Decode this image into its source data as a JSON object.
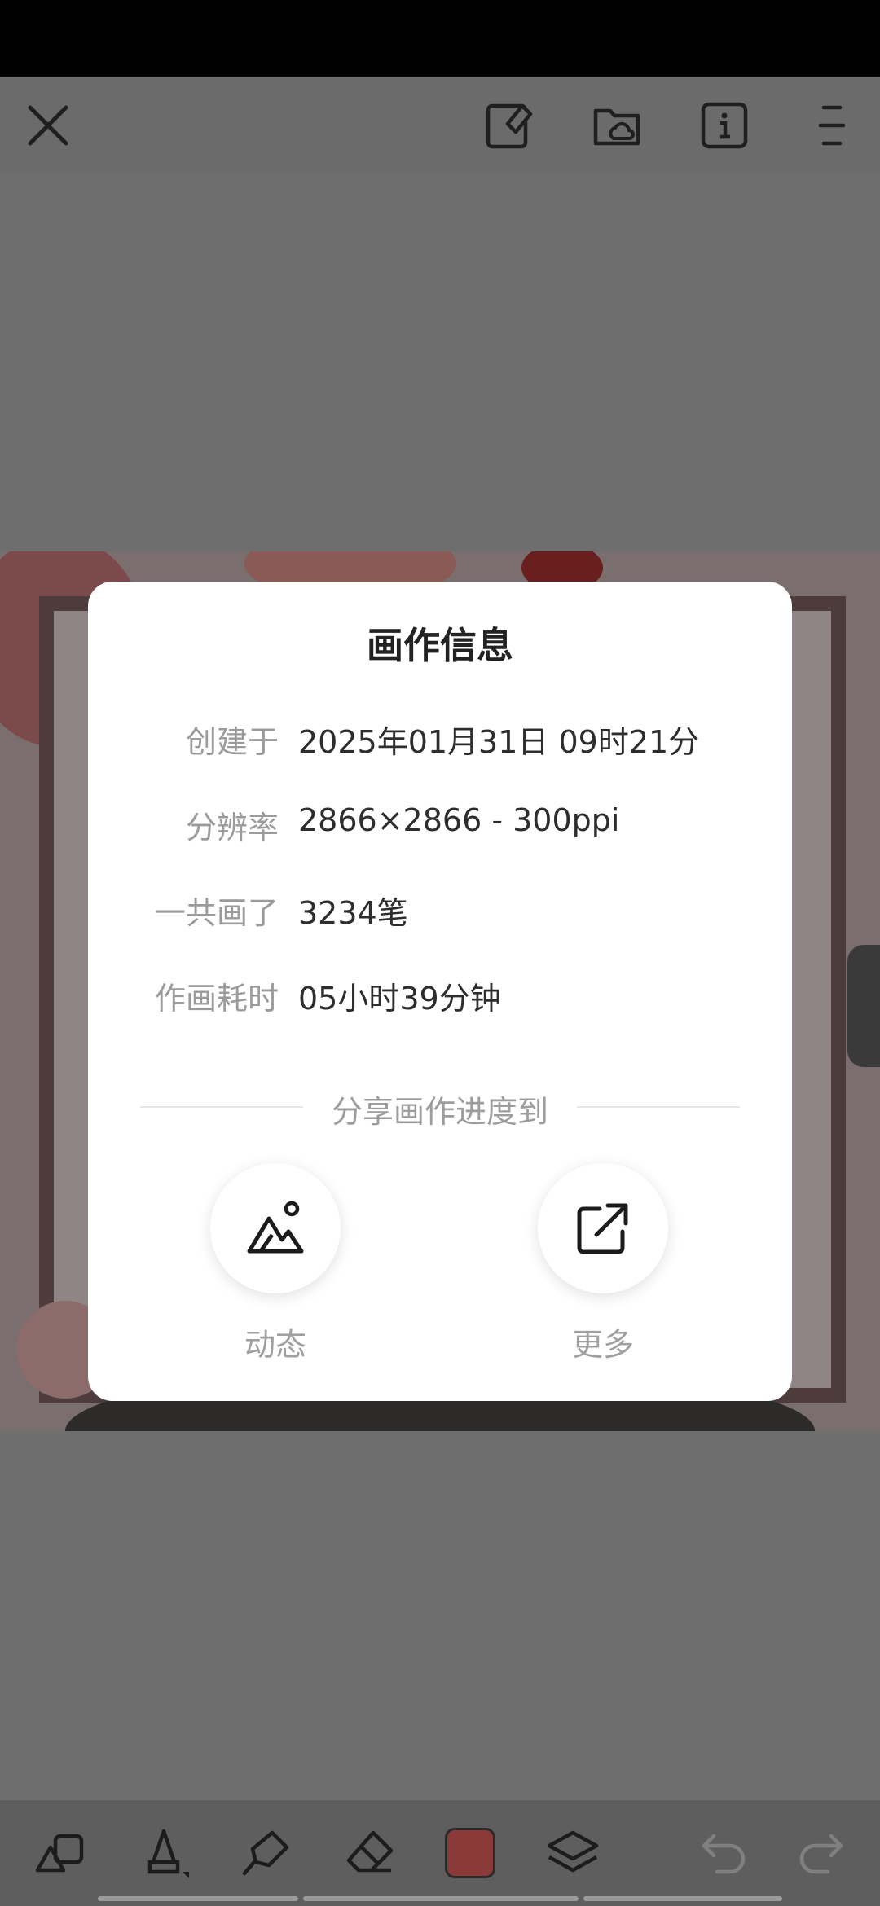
{
  "toolbar": {
    "close": "close-icon",
    "edit_canvas": "canvas-edit-icon",
    "cloud_folder": "cloud-folder-icon",
    "info": "info-icon",
    "menu": "menu-icon"
  },
  "dialog": {
    "title": "画作信息",
    "rows": [
      {
        "label": "创建于",
        "value": "2025年01月31日 09时21分"
      },
      {
        "label": "分辨率",
        "value": "2866×2866 - 300ppi"
      },
      {
        "label": "一共画了",
        "value": "3234笔"
      },
      {
        "label": "作画耗时",
        "value": "05小时39分钟"
      }
    ],
    "share_title": "分享画作进度到",
    "share_options": [
      {
        "label": "动态",
        "icon": "mountain-image-icon"
      },
      {
        "label": "更多",
        "icon": "external-share-icon"
      }
    ]
  },
  "bottom_tools": {
    "shapes": "shapes-icon",
    "brush": "brush-icon",
    "smudge": "smudge-icon",
    "eraser": "eraser-icon",
    "color": "#8b3a3a",
    "layers": "layers-icon",
    "undo": "undo-icon",
    "redo": "redo-icon"
  }
}
